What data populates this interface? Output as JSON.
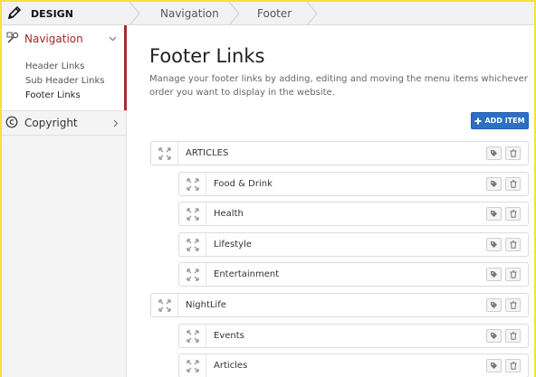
{
  "header": {
    "brand": "DESIGN",
    "breadcrumbs": [
      "Navigation",
      "Footer"
    ]
  },
  "sidebar": {
    "section": {
      "label": "Navigation",
      "items": [
        {
          "label": "Header Links",
          "active": false
        },
        {
          "label": "Sub Header Links",
          "active": false
        },
        {
          "label": "Footer Links",
          "active": true
        }
      ]
    },
    "copyright": {
      "label": "Copyright"
    }
  },
  "main": {
    "title": "Footer Links",
    "description": "Manage your footer links by adding, editing and moving the menu items whichever order you want to display in the website.",
    "add_button": "ADD ITEM",
    "rows": [
      {
        "label": "ARTICLES",
        "level": 0
      },
      {
        "label": "Food & Drink",
        "level": 1
      },
      {
        "label": "Health",
        "level": 1
      },
      {
        "label": "Lifestyle",
        "level": 1
      },
      {
        "label": "Entertainment",
        "level": 1
      },
      {
        "label": "NightLife",
        "level": 0
      },
      {
        "label": "Events",
        "level": 1
      },
      {
        "label": "Articles",
        "level": 1
      }
    ]
  },
  "colors": {
    "accent_red": "#a02a2a",
    "button_blue": "#2c6fc4",
    "frame_yellow": "#f2e33a"
  }
}
